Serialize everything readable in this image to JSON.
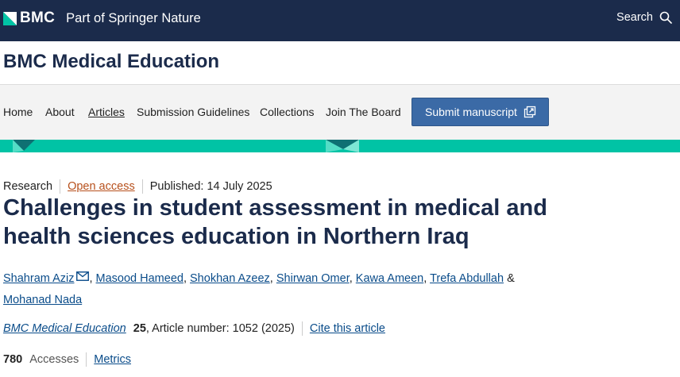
{
  "header": {
    "brand": "BMC",
    "brand_sub": "Part of Springer Nature",
    "search_label": "Search"
  },
  "journal": {
    "title": "BMC Medical Education"
  },
  "nav": {
    "items": [
      {
        "label": "Home"
      },
      {
        "label": "About"
      },
      {
        "label": "Articles"
      },
      {
        "label": "Submission Guidelines"
      },
      {
        "label": "Collections"
      },
      {
        "label": "Join The Board"
      }
    ],
    "active": "Articles",
    "submit_label": "Submit manuscript"
  },
  "article": {
    "type": "Research",
    "access": "Open access",
    "published": "Published: 14 July 2025",
    "title": "Challenges in student assessment in medical and health sciences education in Northern Iraq",
    "authors": [
      "Shahram Aziz",
      "Masood Hameed",
      "Shokhan Azeez",
      "Shirwan Omer",
      "Kawa Ameen",
      "Trefa Abdullah",
      "Mohanad Nada"
    ],
    "author_separator": ",",
    "author_last_separator": "&",
    "journal": "BMC Medical Education",
    "volume": "25",
    "article_number": ", Article number: 1052 (2025)",
    "cite_label": "Cite this article",
    "accesses_count": "780",
    "accesses_label": "Accesses",
    "metrics_label": "Metrics"
  },
  "colors": {
    "brand_navy": "#1b2b4b",
    "accent_teal": "#01c3a5",
    "button_blue": "#3b6aa6",
    "open_access_orange": "#b7501c",
    "link_blue": "#0a4c8a"
  },
  "icons": {
    "brand": "bmc-logo-icon",
    "search": "search-icon",
    "submit": "external-link-icon",
    "corresponding": "mail-icon"
  }
}
